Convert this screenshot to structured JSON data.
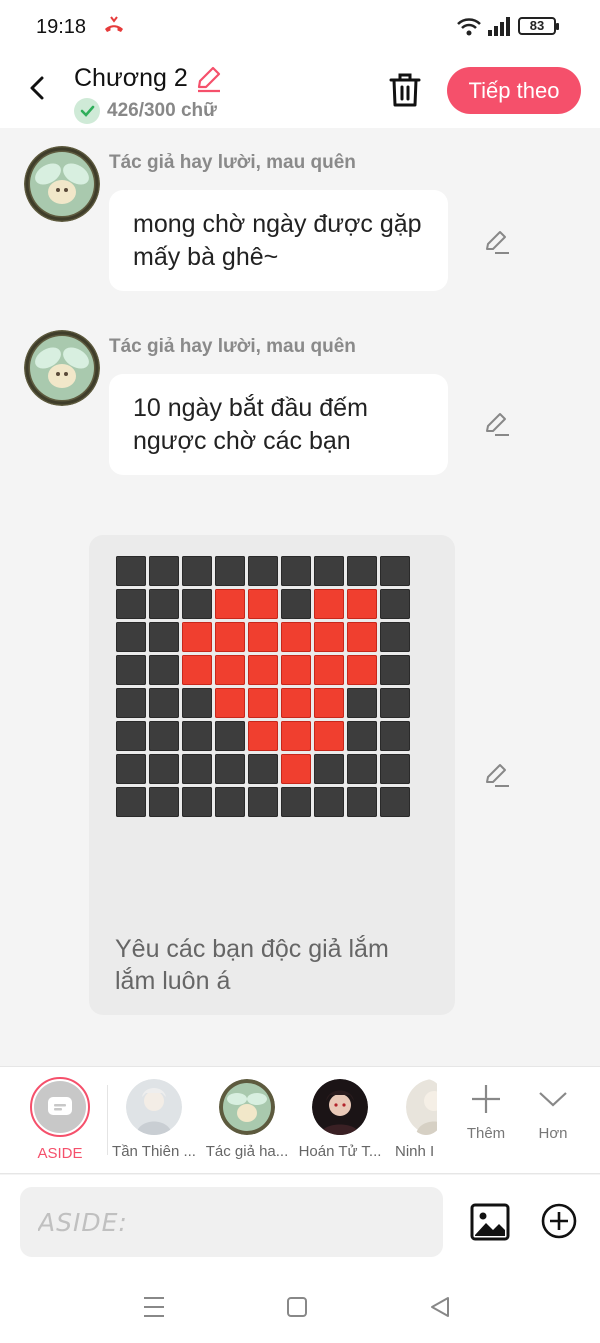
{
  "status_bar": {
    "time": "19:18",
    "battery": "83"
  },
  "header": {
    "title": "Chương 2",
    "word_count": "426/300 chữ",
    "next_label": "Tiếp theo"
  },
  "messages": [
    {
      "author": "Tác giả hay lười, mau quên",
      "text": "mong chờ ngày được gặp mấy bà ghê~"
    },
    {
      "author": "Tác giả hay lười, mau quên",
      "text": "10 ngày bắt đầu đếm ngược chờ các bạn"
    }
  ],
  "image_message": {
    "caption": "Yêu các bạn độc giả lắm lắm luôn á",
    "pixel_rows": [
      "000000000",
      "000110110",
      "001111110",
      "001111110",
      "000111100",
      "000011100",
      "000001000",
      "000000000"
    ]
  },
  "character_bar": {
    "aside_label": "ASIDE",
    "characters": [
      {
        "name": "Tần Thiên ..."
      },
      {
        "name": "Tác giả ha..."
      },
      {
        "name": "Hoán Tử T..."
      },
      {
        "name": "Ninh I"
      }
    ],
    "add_label": "Thêm",
    "more_label": "Hơn"
  },
  "input": {
    "placeholder": "ASIDE:"
  },
  "colors": {
    "accent": "#f5506b",
    "pixel_red": "#f03f2f",
    "pixel_dark": "#3d3d3d"
  }
}
